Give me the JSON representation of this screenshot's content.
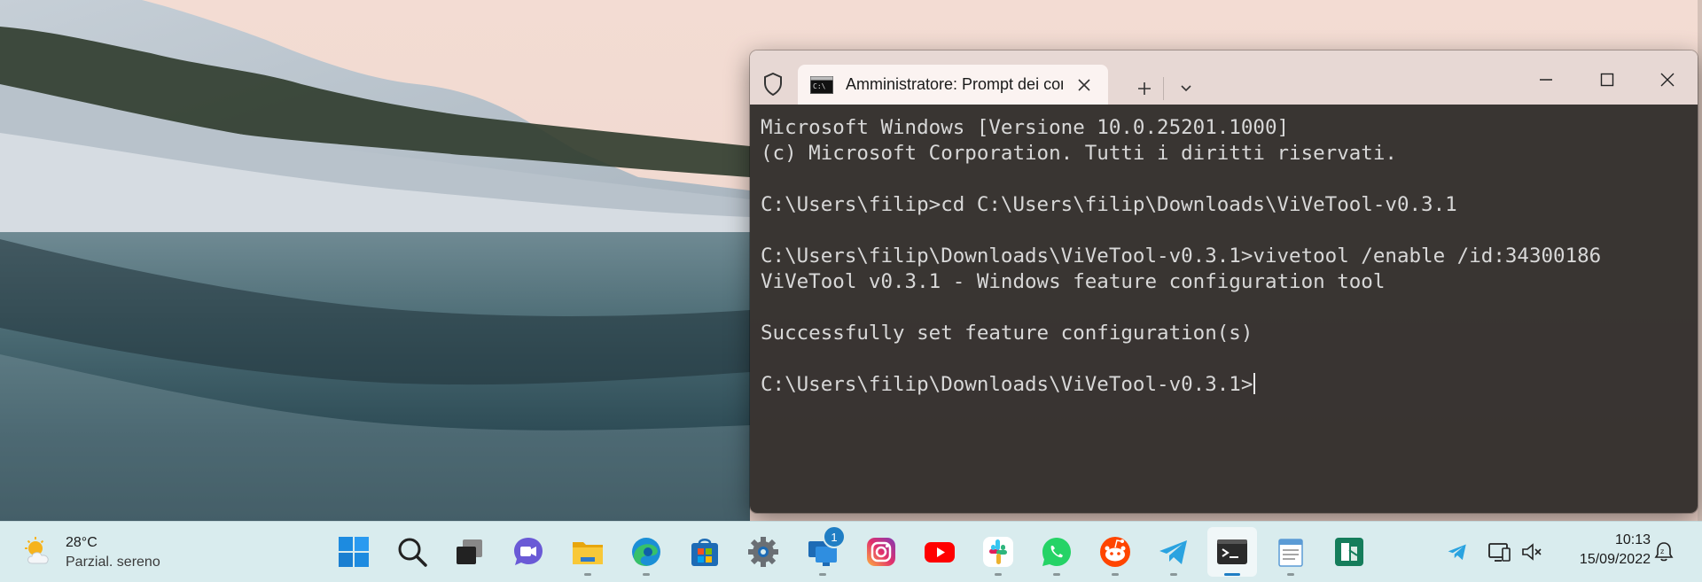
{
  "terminal": {
    "tab_title": "Amministratore: Prompt dei comandi",
    "lines": [
      "Microsoft Windows [Versione 10.0.25201.1000]",
      "(c) Microsoft Corporation. Tutti i diritti riservati.",
      "",
      "C:\\Users\\filip>cd C:\\Users\\filip\\Downloads\\ViVeTool-v0.3.1",
      "",
      "C:\\Users\\filip\\Downloads\\ViVeTool-v0.3.1>vivetool /enable /id:34300186",
      "ViVeTool v0.3.1 - Windows feature configuration tool",
      "",
      "Successfully set feature configuration(s)",
      "",
      "C:\\Users\\filip\\Downloads\\ViVeTool-v0.3.1>"
    ]
  },
  "taskbar": {
    "weather": {
      "temp": "28°C",
      "desc": "Parzial. sereno"
    },
    "apps": [
      {
        "name": "start",
        "icon": "windows-logo-icon"
      },
      {
        "name": "search",
        "icon": "search-icon"
      },
      {
        "name": "task-view",
        "icon": "task-view-icon"
      },
      {
        "name": "chat",
        "icon": "teams-chat-icon"
      },
      {
        "name": "file-explorer",
        "icon": "folder-icon"
      },
      {
        "name": "edge",
        "icon": "edge-icon"
      },
      {
        "name": "store",
        "icon": "store-icon"
      },
      {
        "name": "settings",
        "icon": "gear-icon"
      },
      {
        "name": "remote-desktop",
        "icon": "remote-desktop-icon",
        "badge": "1"
      },
      {
        "name": "instagram",
        "icon": "instagram-icon"
      },
      {
        "name": "youtube",
        "icon": "youtube-icon"
      },
      {
        "name": "slack",
        "icon": "slack-icon"
      },
      {
        "name": "whatsapp",
        "icon": "whatsapp-icon"
      },
      {
        "name": "reddit",
        "icon": "reddit-icon"
      },
      {
        "name": "telegram",
        "icon": "telegram-icon"
      },
      {
        "name": "terminal",
        "icon": "terminal-icon"
      },
      {
        "name": "notepad",
        "icon": "notepad-icon"
      },
      {
        "name": "app-green",
        "icon": "app-icon"
      }
    ],
    "clock": {
      "time": "10:13",
      "date": "15/09/2022"
    }
  },
  "colors": {
    "taskbar_bg": "#d9ecee",
    "titlebar_bg": "#e7d8d4",
    "console_bg": "#2b2826",
    "accent": "#1f7ec4"
  }
}
